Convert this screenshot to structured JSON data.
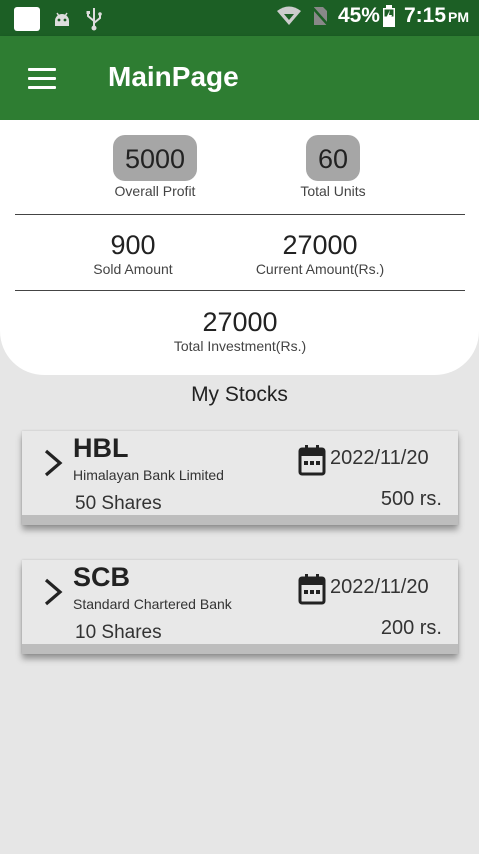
{
  "status_bar": {
    "battery": "45%",
    "time": "7:15",
    "ampm": "PM",
    "icons": [
      "app-square-icon",
      "android-icon",
      "usb-icon",
      "wifi-icon",
      "no-sim-icon",
      "battery-charging-icon"
    ]
  },
  "app_bar": {
    "title": "MainPage",
    "menu_icon": "hamburger-menu-icon"
  },
  "summary": {
    "overall_profit": {
      "value": "5000",
      "label": "Overall Profit"
    },
    "total_units": {
      "value": "60",
      "label": "Total Units"
    },
    "sold_amount": {
      "value": "900",
      "label": "Sold Amount"
    },
    "current_amount": {
      "value": "27000",
      "label": "Current Amount(Rs.)"
    },
    "total_investment": {
      "value": "27000",
      "label": "Total Investment(Rs.)"
    }
  },
  "stocks_section": {
    "title": "My Stocks",
    "items": [
      {
        "ticker": "HBL",
        "name": "Himalayan Bank Limited",
        "shares": "50 Shares",
        "date": "2022/11/20",
        "amount": "500 rs."
      },
      {
        "ticker": "SCB",
        "name": "Standard Chartered Bank",
        "shares": "10 Shares",
        "date": "2022/11/20",
        "amount": "200 rs."
      }
    ]
  },
  "colors": {
    "status_bar": "#1c5f25",
    "app_bar": "#2e7d32",
    "pill": "#a6a6a6",
    "background": "#e6e6e6"
  }
}
